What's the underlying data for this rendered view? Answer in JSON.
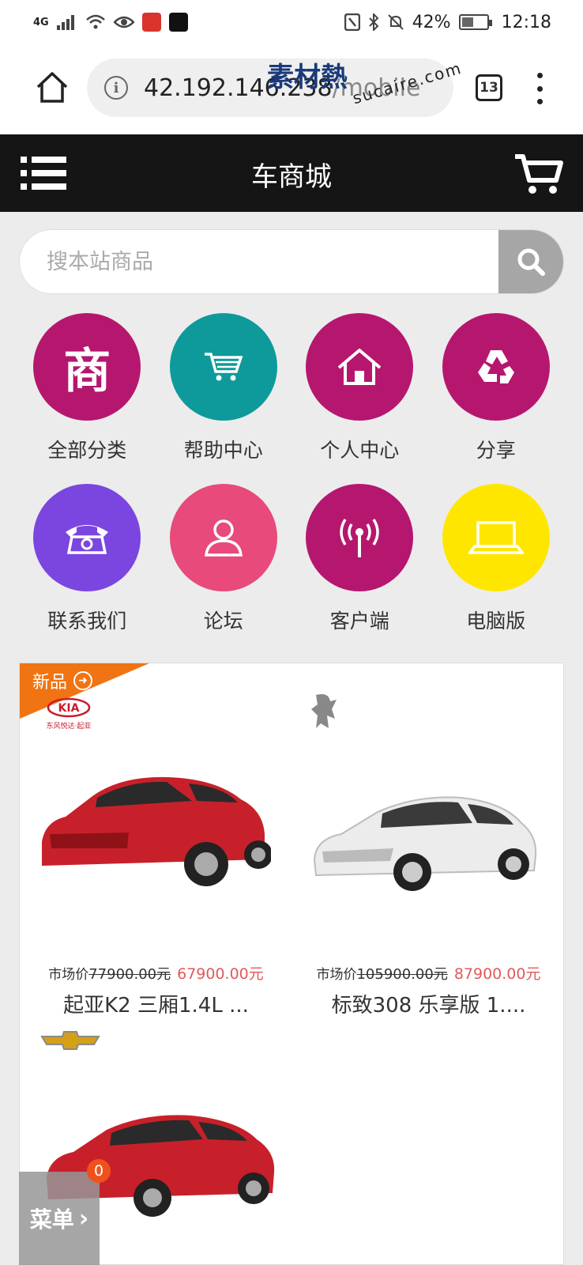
{
  "status_bar": {
    "network": "4G",
    "battery": "42%",
    "time": "12:18"
  },
  "browser": {
    "url_host": "42.192.146.238",
    "url_path": "/mobile",
    "tabs_count": "13"
  },
  "watermark": {
    "logo": "素材熱",
    "text": "sucaire.com"
  },
  "header": {
    "title": "车商城"
  },
  "search": {
    "placeholder": "搜本站商品"
  },
  "categories": [
    {
      "label": "全部分类",
      "icon": "shang-icon",
      "color": "#b5176f",
      "glyph": "商"
    },
    {
      "label": "帮助中心",
      "icon": "cart-icon",
      "color": "#0e9a9a"
    },
    {
      "label": "个人中心",
      "icon": "home-icon",
      "color": "#b5176f"
    },
    {
      "label": "分享",
      "icon": "recycle-icon",
      "color": "#b5176f"
    },
    {
      "label": "联系我们",
      "icon": "phone-icon",
      "color": "#7b45e0"
    },
    {
      "label": "论坛",
      "icon": "user-icon",
      "color": "#e74a7b"
    },
    {
      "label": "客户端",
      "icon": "signal-icon",
      "color": "#b5176f"
    },
    {
      "label": "电脑版",
      "icon": "laptop-icon",
      "color": "#ffe600"
    }
  ],
  "products_panel": {
    "badge": "新品",
    "products": [
      {
        "name": "起亚K2 三厢1.4L ...",
        "market_label": "市场价",
        "market_price": "77900.00元",
        "price": "67900.00元",
        "brand": "KIA",
        "brand_sub": "东风悦达·起亚",
        "car_color": "#c8202a"
      },
      {
        "name": "标致308 乐享版 1....",
        "market_label": "市场价",
        "market_price": "105900.00元",
        "price": "87900.00元",
        "brand": "peugeot-logo",
        "car_color": "#e9e9e9"
      },
      {
        "name": "",
        "brand": "chevrolet-logo",
        "car_color": "#c8202a"
      }
    ]
  },
  "float_menu": {
    "label": "菜单",
    "badge": "0"
  }
}
